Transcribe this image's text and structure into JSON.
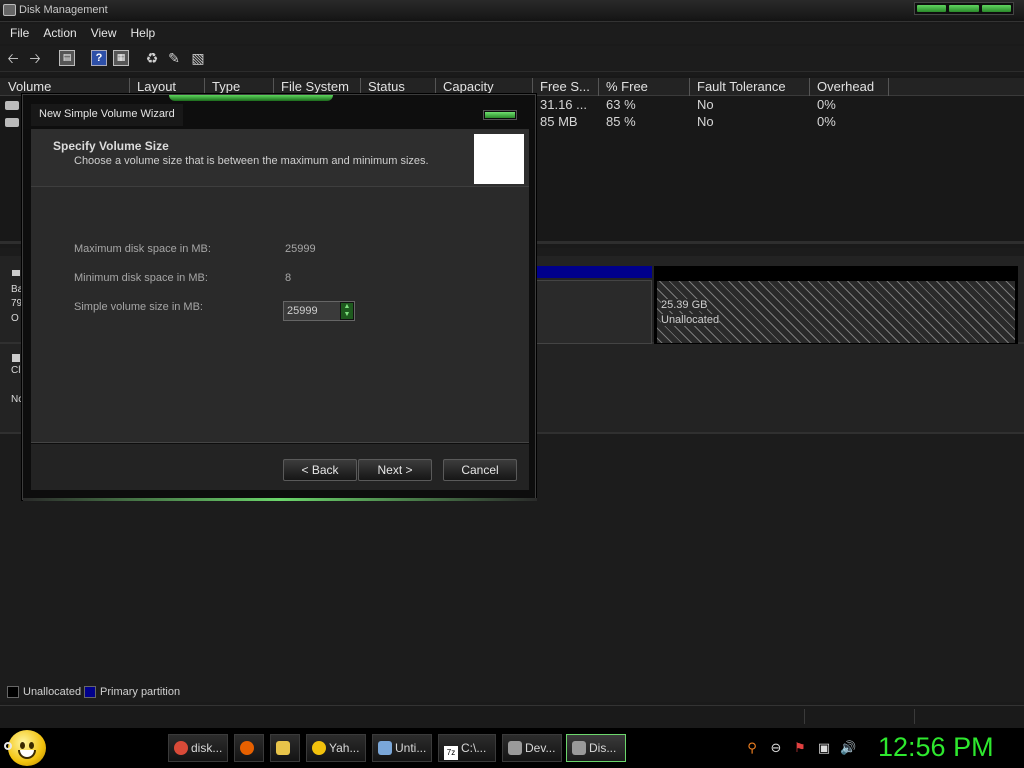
{
  "window": {
    "title": "Disk Management"
  },
  "menu": [
    "File",
    "Action",
    "View",
    "Help"
  ],
  "toolbar": {
    "icons": [
      "back-arrow-icon",
      "forward-arrow-icon",
      "console-tree-icon",
      "help-icon",
      "properties-icon",
      "refresh-icon",
      "export-list-icon",
      "rescan-disks-icon"
    ]
  },
  "volume_list": {
    "columns": [
      "Volume",
      "Layout",
      "Type",
      "File System",
      "Status",
      "Capacity",
      "Free S...",
      "% Free",
      "Fault Tolerance",
      "Overhead"
    ],
    "rows": [
      {
        "free": "31.16 ...",
        "pct_free": "63 %",
        "fault": "No",
        "overhead": "0%"
      },
      {
        "free": "85 MB",
        "pct_free": "85 %",
        "fault": "No",
        "overhead": "0%"
      }
    ]
  },
  "disks": {
    "disk0_label_fragments": [
      "Ba",
      "79",
      "O"
    ],
    "cdrom_fragments": [
      "Cl",
      "Nc"
    ],
    "unallocated_size": "25.39 GB",
    "unallocated_label": "Unallocated"
  },
  "legend": [
    {
      "label": "Unallocated",
      "color": "#000000"
    },
    {
      "label": "Primary partition",
      "color": "#00008b"
    }
  ],
  "wizard": {
    "title": "New Simple Volume Wizard",
    "header_title": "Specify Volume Size",
    "header_subtitle": "Choose a volume size that is between the maximum and minimum sizes.",
    "fields": {
      "max_label": "Maximum disk space in MB:",
      "max_value": "25999",
      "min_label": "Minimum disk space in MB:",
      "min_value": "8",
      "size_label": "Simple volume size in MB:",
      "size_value": "25999"
    },
    "buttons": {
      "back": "< Back",
      "next": "Next >",
      "cancel": "Cancel"
    }
  },
  "taskbar": {
    "tasks": [
      {
        "label": "disk...",
        "icon": "chrome-icon",
        "color": "#d94a38"
      },
      {
        "label": "",
        "icon": "firefox-icon",
        "color": "#e66000"
      },
      {
        "label": "",
        "icon": "folder-icon",
        "color": "#e8c44a"
      },
      {
        "label": "Yah...",
        "icon": "yahoo-messenger-icon",
        "color": "#f2c20d"
      },
      {
        "label": "Unti...",
        "icon": "paint-icon",
        "color": "#7aa7d9"
      },
      {
        "label": "C:\\...",
        "icon": "7zip-icon",
        "color": "#ffffff"
      },
      {
        "label": "Dev...",
        "icon": "device-manager-icon",
        "color": "#9a9a9a"
      },
      {
        "label": "Dis...",
        "icon": "disk-management-icon",
        "color": "#9a9a9a"
      }
    ],
    "clock": "12:56 PM",
    "tray_icons": [
      "search-icon",
      "minus-circle-icon",
      "action-center-flag-icon",
      "network-icon",
      "volume-icon"
    ]
  },
  "colors": {
    "accent": "#2ee82e",
    "primary_partition": "#00008b"
  }
}
